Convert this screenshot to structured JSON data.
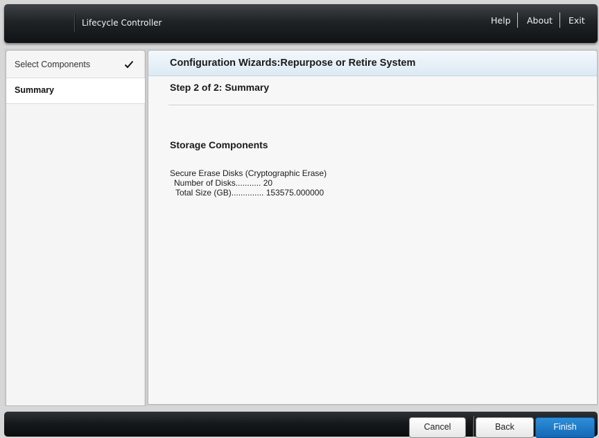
{
  "header": {
    "app_title": "Lifecycle Controller",
    "help_label": "Help",
    "about_label": "About",
    "exit_label": "Exit"
  },
  "sidebar": {
    "items": [
      {
        "label": "Select Components",
        "completed": true
      },
      {
        "label": "Summary",
        "active": true
      }
    ]
  },
  "content": {
    "title": "Configuration Wizards:Repurpose or Retire System",
    "step_heading": "Step 2 of 2: Summary",
    "section_heading": "Storage Components",
    "detail_title": "Secure Erase Disks (Cryptographic Erase)",
    "detail_disks": "Number of Disks........... 20",
    "detail_size": "Total Size (GB).............. 153575.000000"
  },
  "footer": {
    "cancel_label": "Cancel",
    "back_label": "Back",
    "finish_label": "Finish"
  },
  "colors": {
    "accent": "#1c78c8",
    "header_bg": "#1f2326",
    "title_bar_bg": "#dceaf4"
  }
}
